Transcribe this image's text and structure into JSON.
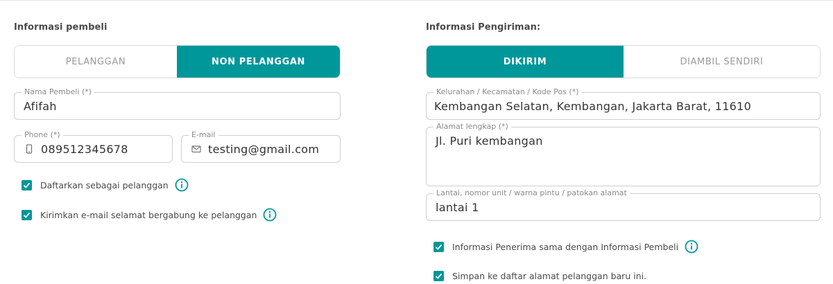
{
  "buyer": {
    "heading": "Informasi pembeli",
    "tabs": [
      "PELANGGAN",
      "NON PELANGGAN"
    ],
    "active_tab": "NON PELANGGAN",
    "name": {
      "label": "Nama Pembeli (*)",
      "value": "Afifah"
    },
    "phone": {
      "label": "Phone (*)",
      "value": "089512345678",
      "icon": "phone-icon"
    },
    "email": {
      "label": "E-mail",
      "value": "testing@gmail.com",
      "icon": "mail-icon"
    },
    "checks": [
      {
        "label": "Daftarkan sebagai pelanggan",
        "checked": true
      },
      {
        "label": "Kirimkan e-mail selamat bergabung ke pelanggan",
        "checked": true
      }
    ]
  },
  "shipping": {
    "heading": "Informasi Pengiriman:",
    "tabs": [
      "DIKIRIM",
      "DIAMBIL SENDIRI"
    ],
    "active_tab": "DIKIRIM",
    "area": {
      "label": "Kelurahan / Kecamatan / Kode Pos (*)",
      "value": "Kembangan Selatan, Kembangan, Jakarta Barat, 11610"
    },
    "address": {
      "label": "Alamat lengkap (*)",
      "value": "Jl. Puri kembangan"
    },
    "detail": {
      "label": "Lantai, nomor unit / warna pintu / patokan alamat",
      "value": "lantai 1"
    },
    "checks": [
      {
        "label": "Informasi Penerima sama dengan Informasi Pembeli",
        "checked": true
      },
      {
        "label": "Simpan ke daftar alamat pelanggan baru ini.",
        "checked": true
      }
    ]
  },
  "colors": {
    "accent": "#00979a",
    "border": "#cfcfcf",
    "muted": "#9a9a9a"
  }
}
